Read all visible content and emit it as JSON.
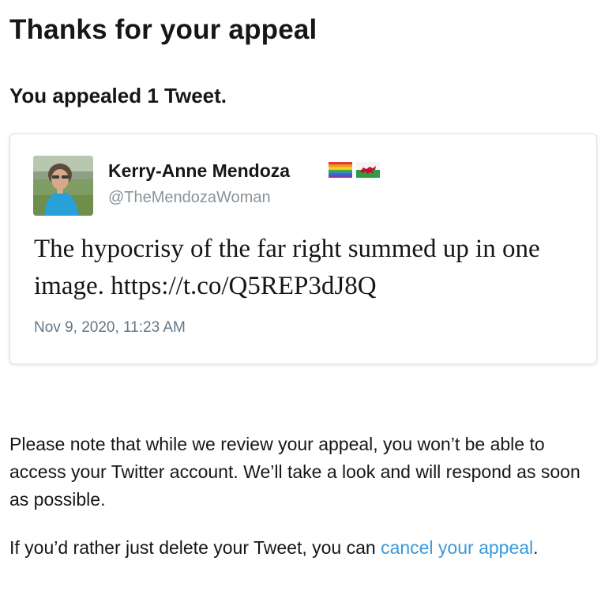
{
  "header": {
    "title": "Thanks for your appeal",
    "subtitle": "You appealed 1 Tweet."
  },
  "tweet": {
    "author_name": "Kerry-Anne Mendoza",
    "author_handle": "@TheMendozaWoman",
    "flags": [
      "rainbow-flag-icon",
      "wales-flag-icon"
    ],
    "text": "The hypocrisy of the far right summed up in one image. https://t.co/Q5REP3dJ8Q",
    "timestamp": "Nov 9, 2020, 11:23 AM"
  },
  "notice": {
    "text": "Please note that while we review your appeal, you won’t be able to access your Twitter account. We’ll take a look and will respond as soon as possible."
  },
  "cancel": {
    "prefix": "If you’d rather just delete your Tweet, you can ",
    "link_text": "cancel your appeal",
    "suffix": "."
  },
  "colors": {
    "link": "#3b9ad9",
    "text": "#14171a",
    "muted": "#8a9299"
  }
}
